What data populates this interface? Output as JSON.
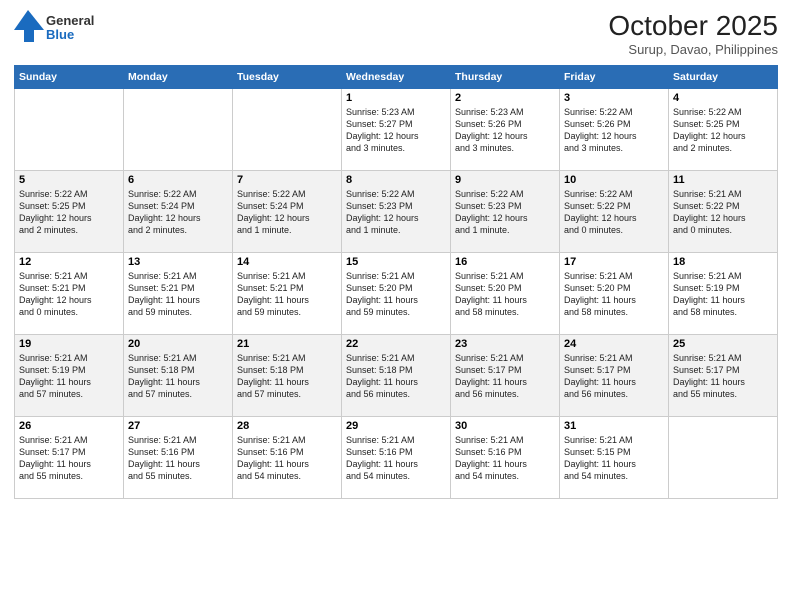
{
  "logo": {
    "general": "General",
    "blue": "Blue"
  },
  "title": "October 2025",
  "location": "Surup, Davao, Philippines",
  "weekdays": [
    "Sunday",
    "Monday",
    "Tuesday",
    "Wednesday",
    "Thursday",
    "Friday",
    "Saturday"
  ],
  "weeks": [
    [
      {
        "day": "",
        "info": ""
      },
      {
        "day": "",
        "info": ""
      },
      {
        "day": "",
        "info": ""
      },
      {
        "day": "1",
        "info": "Sunrise: 5:23 AM\nSunset: 5:27 PM\nDaylight: 12 hours\nand 3 minutes."
      },
      {
        "day": "2",
        "info": "Sunrise: 5:23 AM\nSunset: 5:26 PM\nDaylight: 12 hours\nand 3 minutes."
      },
      {
        "day": "3",
        "info": "Sunrise: 5:22 AM\nSunset: 5:26 PM\nDaylight: 12 hours\nand 3 minutes."
      },
      {
        "day": "4",
        "info": "Sunrise: 5:22 AM\nSunset: 5:25 PM\nDaylight: 12 hours\nand 2 minutes."
      }
    ],
    [
      {
        "day": "5",
        "info": "Sunrise: 5:22 AM\nSunset: 5:25 PM\nDaylight: 12 hours\nand 2 minutes."
      },
      {
        "day": "6",
        "info": "Sunrise: 5:22 AM\nSunset: 5:24 PM\nDaylight: 12 hours\nand 2 minutes."
      },
      {
        "day": "7",
        "info": "Sunrise: 5:22 AM\nSunset: 5:24 PM\nDaylight: 12 hours\nand 1 minute."
      },
      {
        "day": "8",
        "info": "Sunrise: 5:22 AM\nSunset: 5:23 PM\nDaylight: 12 hours\nand 1 minute."
      },
      {
        "day": "9",
        "info": "Sunrise: 5:22 AM\nSunset: 5:23 PM\nDaylight: 12 hours\nand 1 minute."
      },
      {
        "day": "10",
        "info": "Sunrise: 5:22 AM\nSunset: 5:22 PM\nDaylight: 12 hours\nand 0 minutes."
      },
      {
        "day": "11",
        "info": "Sunrise: 5:21 AM\nSunset: 5:22 PM\nDaylight: 12 hours\nand 0 minutes."
      }
    ],
    [
      {
        "day": "12",
        "info": "Sunrise: 5:21 AM\nSunset: 5:21 PM\nDaylight: 12 hours\nand 0 minutes."
      },
      {
        "day": "13",
        "info": "Sunrise: 5:21 AM\nSunset: 5:21 PM\nDaylight: 11 hours\nand 59 minutes."
      },
      {
        "day": "14",
        "info": "Sunrise: 5:21 AM\nSunset: 5:21 PM\nDaylight: 11 hours\nand 59 minutes."
      },
      {
        "day": "15",
        "info": "Sunrise: 5:21 AM\nSunset: 5:20 PM\nDaylight: 11 hours\nand 59 minutes."
      },
      {
        "day": "16",
        "info": "Sunrise: 5:21 AM\nSunset: 5:20 PM\nDaylight: 11 hours\nand 58 minutes."
      },
      {
        "day": "17",
        "info": "Sunrise: 5:21 AM\nSunset: 5:20 PM\nDaylight: 11 hours\nand 58 minutes."
      },
      {
        "day": "18",
        "info": "Sunrise: 5:21 AM\nSunset: 5:19 PM\nDaylight: 11 hours\nand 58 minutes."
      }
    ],
    [
      {
        "day": "19",
        "info": "Sunrise: 5:21 AM\nSunset: 5:19 PM\nDaylight: 11 hours\nand 57 minutes."
      },
      {
        "day": "20",
        "info": "Sunrise: 5:21 AM\nSunset: 5:18 PM\nDaylight: 11 hours\nand 57 minutes."
      },
      {
        "day": "21",
        "info": "Sunrise: 5:21 AM\nSunset: 5:18 PM\nDaylight: 11 hours\nand 57 minutes."
      },
      {
        "day": "22",
        "info": "Sunrise: 5:21 AM\nSunset: 5:18 PM\nDaylight: 11 hours\nand 56 minutes."
      },
      {
        "day": "23",
        "info": "Sunrise: 5:21 AM\nSunset: 5:17 PM\nDaylight: 11 hours\nand 56 minutes."
      },
      {
        "day": "24",
        "info": "Sunrise: 5:21 AM\nSunset: 5:17 PM\nDaylight: 11 hours\nand 56 minutes."
      },
      {
        "day": "25",
        "info": "Sunrise: 5:21 AM\nSunset: 5:17 PM\nDaylight: 11 hours\nand 55 minutes."
      }
    ],
    [
      {
        "day": "26",
        "info": "Sunrise: 5:21 AM\nSunset: 5:17 PM\nDaylight: 11 hours\nand 55 minutes."
      },
      {
        "day": "27",
        "info": "Sunrise: 5:21 AM\nSunset: 5:16 PM\nDaylight: 11 hours\nand 55 minutes."
      },
      {
        "day": "28",
        "info": "Sunrise: 5:21 AM\nSunset: 5:16 PM\nDaylight: 11 hours\nand 54 minutes."
      },
      {
        "day": "29",
        "info": "Sunrise: 5:21 AM\nSunset: 5:16 PM\nDaylight: 11 hours\nand 54 minutes."
      },
      {
        "day": "30",
        "info": "Sunrise: 5:21 AM\nSunset: 5:16 PM\nDaylight: 11 hours\nand 54 minutes."
      },
      {
        "day": "31",
        "info": "Sunrise: 5:21 AM\nSunset: 5:15 PM\nDaylight: 11 hours\nand 54 minutes."
      },
      {
        "day": "",
        "info": ""
      }
    ]
  ]
}
